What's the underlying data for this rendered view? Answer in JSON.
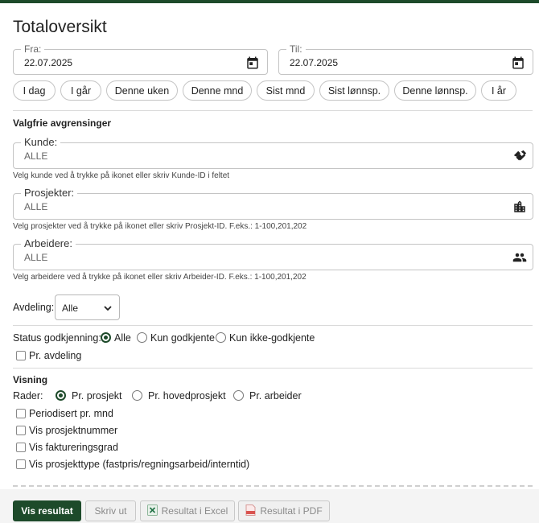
{
  "title": "Totaloversikt",
  "date_from": {
    "label": "Fra:",
    "value": "22.07.2025",
    "icon": "calendar-icon"
  },
  "date_to": {
    "label": "Til:",
    "value": "22.07.2025",
    "icon": "calendar-icon"
  },
  "quick_ranges": [
    "I dag",
    "I går",
    "Denne uken",
    "Denne mnd",
    "Sist mnd",
    "Sist lønnsp.",
    "Denne lønnsp.",
    "I år"
  ],
  "filters_section": {
    "heading": "Valgfrie avgrensinger",
    "customer": {
      "label": "Kunde:",
      "value": "ALLE",
      "help": "Velg kunde ved å trykke på ikonet eller skriv Kunde-ID i feltet",
      "icon": "handshake-icon"
    },
    "projects": {
      "label": "Prosjekter:",
      "value": "ALLE",
      "help": "Velg prosjekter ved å trykke på ikonet eller skriv Prosjekt-ID. F.eks.: 1-100,201,202",
      "icon": "building-icon"
    },
    "workers": {
      "label": "Arbeidere:",
      "value": "ALLE",
      "help": "Velg arbeidere ved å trykke på ikonet eller skriv Arbeider-ID. F.eks.: 1-100,201,202",
      "icon": "people-icon"
    }
  },
  "department": {
    "label": "Avdeling:",
    "selected": "Alle"
  },
  "approval": {
    "label": "Status godkjenning:",
    "options": [
      "Alle",
      "Kun godkjente",
      "Kun ikke-godkjente"
    ],
    "selected": "Alle",
    "per_department": {
      "label": "Pr. avdeling",
      "checked": false
    }
  },
  "view": {
    "heading": "Visning",
    "rows_label": "Rader:",
    "rows_options": [
      "Pr. prosjekt",
      "Pr. hovedprosjekt",
      "Pr. arbeider"
    ],
    "rows_selected": "Pr. prosjekt",
    "checkboxes": [
      {
        "label": "Periodisert pr. mnd",
        "checked": false
      },
      {
        "label": "Vis prosjektnummer",
        "checked": false
      },
      {
        "label": "Vis faktureringsgrad",
        "checked": false
      },
      {
        "label": "Vis prosjekttype (fastpris/regningsarbeid/interntid)",
        "checked": false
      }
    ]
  },
  "actions": {
    "show": "Vis resultat",
    "print": "Skriv ut",
    "excel": "Resultat i Excel",
    "pdf": "Resultat i PDF"
  },
  "colors": {
    "accent": "#1d4a2a",
    "border": "#c4c4c4",
    "excel_green": "#1d6f42",
    "pdf_red": "#d9534f"
  }
}
